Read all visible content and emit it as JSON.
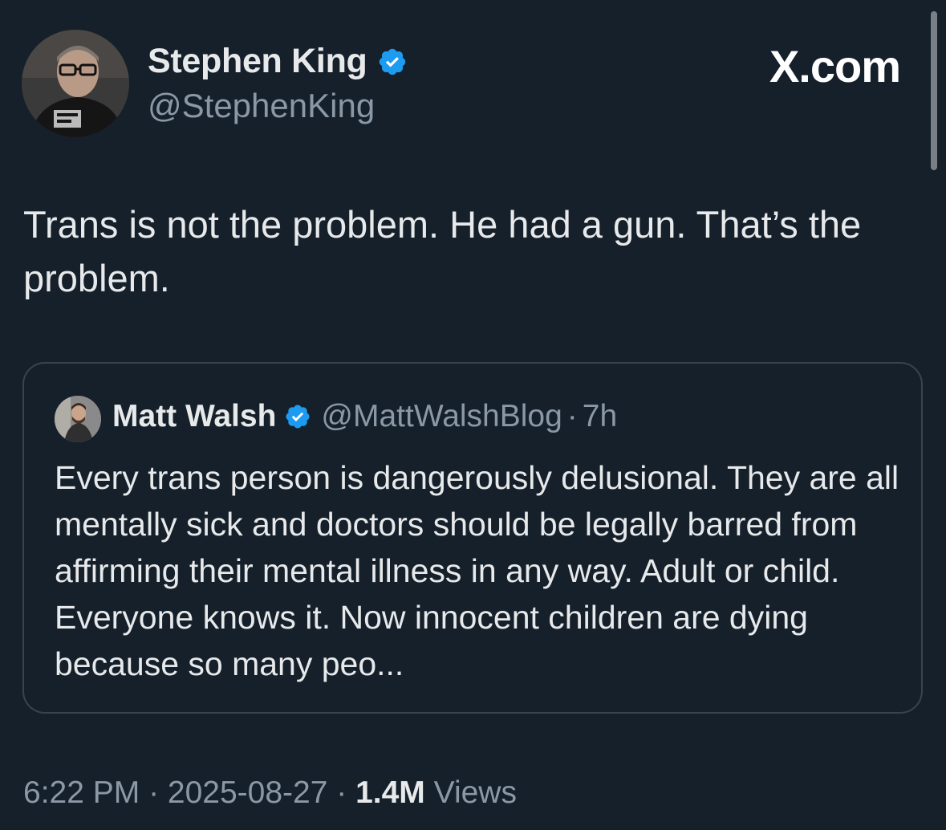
{
  "author": {
    "display_name": "Stephen King",
    "handle": "@StephenKing",
    "verified_icon": "verified-badge-icon"
  },
  "brand": "X.com",
  "tweet": {
    "text": "Trans is not the problem. He had a gun. That’s the problem."
  },
  "quoted_tweet": {
    "display_name": "Matt Walsh",
    "handle": "@MattWalshBlog",
    "separator": "·",
    "time": "7h",
    "text": "Every trans person is dangerously delusional. They are all mentally sick and doctors should be legally barred from affirming their mental illness in any way. Adult or child. Everyone knows it. Now innocent children are dying because so many peo..."
  },
  "meta": {
    "time": "6:22 PM",
    "sep1": " · ",
    "date": "2025-08-27",
    "sep2": " · ",
    "views_count": "1.4M",
    "views_label": " Views"
  },
  "colors": {
    "background": "#15202b",
    "primary_text": "#e7e9ea",
    "secondary_text": "#8b98a5",
    "verified_blue": "#1d9bf0",
    "card_border": "#38444d"
  }
}
